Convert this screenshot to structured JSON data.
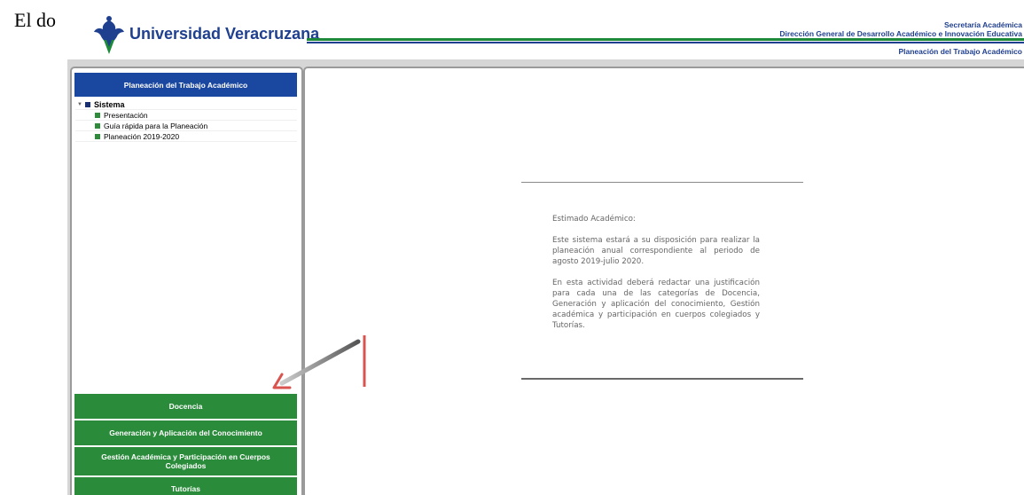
{
  "document": {
    "leading_text": "El do"
  },
  "header": {
    "university_name": "Universidad Veracruzana",
    "secretaria": "Secretaría Académica",
    "direccion": "Dirección General de Desarrollo Académico e Innovación Educativa",
    "system_title": "Planeación del Trabajo Académico",
    "colors": {
      "blue": "#1f3f8f",
      "green": "#1d8a3a"
    }
  },
  "sidebar": {
    "title": "Planeación del Trabajo Académico",
    "tree": {
      "root": "Sistema",
      "items": [
        {
          "label": "Presentación"
        },
        {
          "label": "Guía rápida para la Planeación"
        },
        {
          "label": "Planeación 2019-2020"
        }
      ]
    },
    "nav": [
      {
        "label": "Docencia"
      },
      {
        "label": "Generación y Aplicación del Conocimiento"
      },
      {
        "label": "Gestión Académica y Participación en Cuerpos Colegiados"
      },
      {
        "label": "Tutorías"
      }
    ],
    "colors": {
      "title_bg": "#1a47a0",
      "nav_bg": "#2a8b3a"
    }
  },
  "main": {
    "greeting": "Estimado Académico:",
    "paragraph1": "Este sistema estará a su disposición para realizar la planeación anual correspondiente al periodo de agosto 2019-julio 2020.",
    "paragraph2": "En esta actividad deberá redactar una justificación para cada una de las categorías de Docencia, Generación y aplicación del conocimiento, Gestión académica y participación en cuerpos colegiados y Tutorías."
  },
  "annotation": {
    "color": "#d9534f",
    "icon": "arrow-icon"
  }
}
